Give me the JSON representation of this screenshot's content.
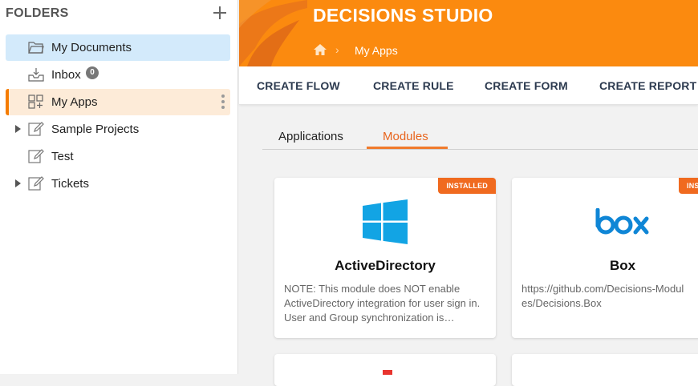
{
  "sidebar": {
    "header": "FOLDERS",
    "items": [
      {
        "label": "My Documents",
        "icon": "folder-open-icon"
      },
      {
        "label": "Inbox",
        "icon": "inbox-icon",
        "count": "0"
      },
      {
        "label": "My Apps",
        "icon": "apps-grid-icon"
      },
      {
        "label": "Sample Projects",
        "icon": "edit-document-icon"
      },
      {
        "label": "Test",
        "icon": "edit-document-icon"
      },
      {
        "label": "Tickets",
        "icon": "edit-document-icon"
      }
    ]
  },
  "header": {
    "title": "DECISIONS STUDIO",
    "breadcrumb": "My Apps",
    "background_color": "#fb8a0f"
  },
  "toolbar": {
    "create_flow": "CREATE FLOW",
    "create_rule": "CREATE RULE",
    "create_form": "CREATE FORM",
    "create_report": "CREATE REPORT"
  },
  "tabs": {
    "applications": "Applications",
    "modules": "Modules",
    "active": "Modules",
    "accent_color": "#e8651e"
  },
  "cards": [
    {
      "badge": "INSTALLED",
      "title": "ActiveDirectory",
      "icon": "windows-logo-icon",
      "description": "NOTE: This module does NOT enable ActiveDirectory integration for user sign in.  User and Group synchronization is available through this module."
    },
    {
      "badge": "INSTALLED",
      "title": "Box",
      "icon": "box-logo-icon",
      "description": "https://github.com/Decisions-Modules/Decisions.Box"
    }
  ]
}
